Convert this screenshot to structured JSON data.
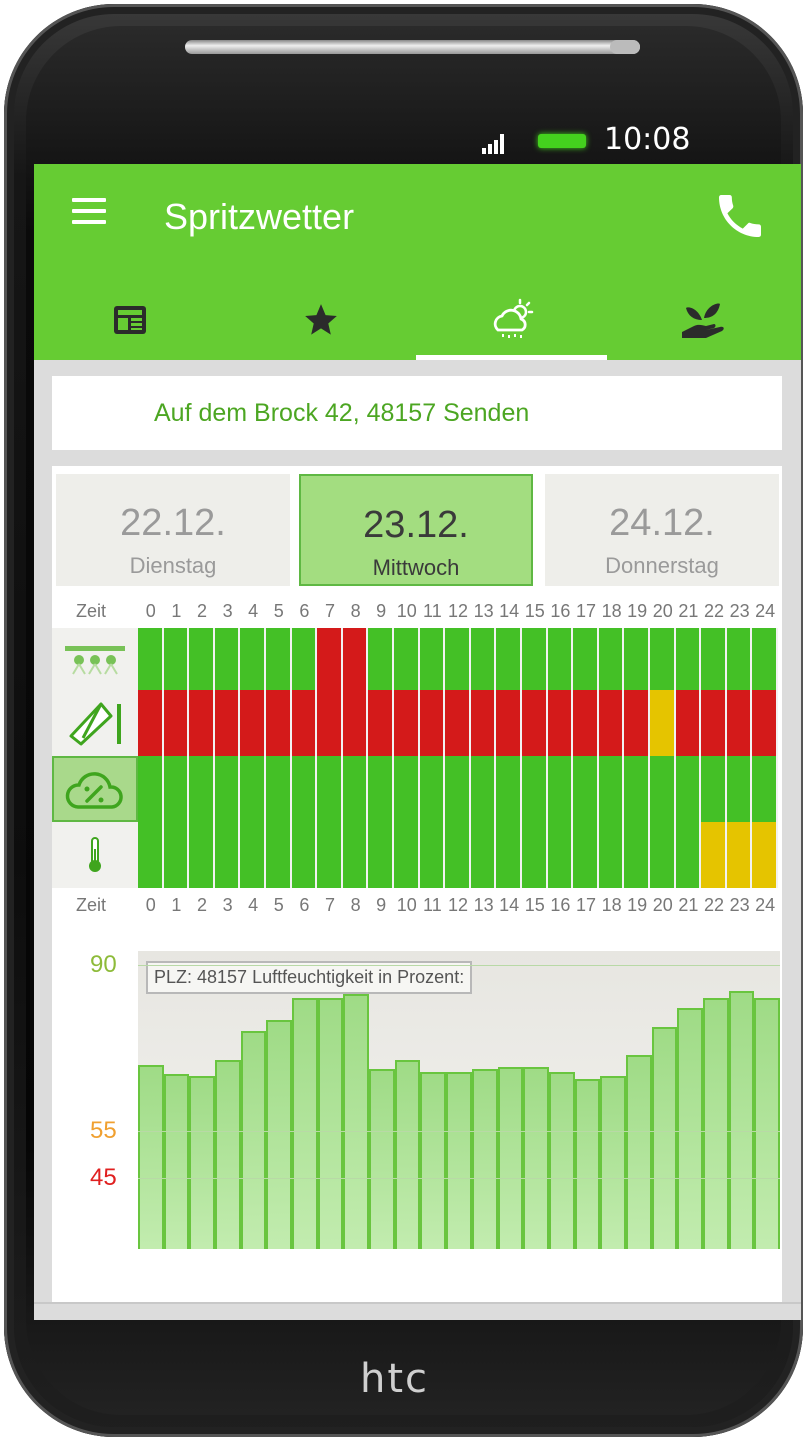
{
  "status_bar": {
    "time": "10:08"
  },
  "app_bar": {
    "title": "Spritzwetter"
  },
  "icons": {
    "menu": "menu-icon",
    "call": "phone-icon",
    "tabs": [
      "news-icon",
      "star-icon",
      "weather-icon",
      "plant-hand-icon"
    ]
  },
  "tabs": {
    "active_index": 2
  },
  "address": "Auf dem Brock 42, 48157 Senden",
  "days": [
    {
      "date": "22.12.",
      "weekday": "Dienstag",
      "active": false
    },
    {
      "date": "23.12.",
      "weekday": "Mittwoch",
      "active": true
    },
    {
      "date": "24.12.",
      "weekday": "Donnerstag",
      "active": false
    }
  ],
  "timeline": {
    "label": "Zeit",
    "hours": [
      "0",
      "1",
      "2",
      "3",
      "4",
      "5",
      "6",
      "7",
      "8",
      "9",
      "10",
      "11",
      "12",
      "13",
      "14",
      "15",
      "16",
      "17",
      "18",
      "19",
      "20",
      "21",
      "22",
      "23",
      "24"
    ]
  },
  "grid_rows": [
    {
      "icon": "sprayer-icon",
      "selected": false,
      "statuses": [
        "g",
        "g",
        "g",
        "g",
        "g",
        "g",
        "g",
        "r",
        "r",
        "g",
        "g",
        "g",
        "g",
        "g",
        "g",
        "g",
        "g",
        "g",
        "g",
        "g",
        "g",
        "g",
        "g",
        "g",
        "g"
      ]
    },
    {
      "icon": "wind-sock-icon",
      "selected": false,
      "statuses": [
        "r",
        "r",
        "r",
        "r",
        "r",
        "r",
        "r",
        "r",
        "r",
        "r",
        "r",
        "r",
        "r",
        "r",
        "r",
        "r",
        "r",
        "r",
        "r",
        "r",
        "y",
        "r",
        "r",
        "r",
        "r"
      ]
    },
    {
      "icon": "cloud-humidity-icon",
      "selected": true,
      "statuses": [
        "g",
        "g",
        "g",
        "g",
        "g",
        "g",
        "g",
        "g",
        "g",
        "g",
        "g",
        "g",
        "g",
        "g",
        "g",
        "g",
        "g",
        "g",
        "g",
        "g",
        "g",
        "g",
        "g",
        "g",
        "g"
      ]
    },
    {
      "icon": "thermometer-icon",
      "selected": false,
      "statuses": [
        "g",
        "g",
        "g",
        "g",
        "g",
        "g",
        "g",
        "g",
        "g",
        "g",
        "g",
        "g",
        "g",
        "g",
        "g",
        "g",
        "g",
        "g",
        "g",
        "g",
        "g",
        "g",
        "y",
        "y",
        "y"
      ]
    }
  ],
  "status_colors": {
    "g": "#44c026",
    "r": "#d41a1a",
    "y": "#e5c400"
  },
  "chart_data": {
    "type": "bar",
    "title": "PLZ: 48157 Luftfeuchtigkeit in Prozent:",
    "categories": [
      "0",
      "1",
      "2",
      "3",
      "4",
      "5",
      "6",
      "7",
      "8",
      "9",
      "10",
      "11",
      "12",
      "13",
      "14",
      "15",
      "16",
      "17",
      "18",
      "19",
      "20",
      "21",
      "22",
      "23",
      "24"
    ],
    "values": [
      69,
      67,
      66.5,
      70,
      76,
      78.5,
      83,
      83,
      84,
      68,
      70,
      67.5,
      67.5,
      68,
      68.5,
      68.5,
      67.5,
      66,
      66.5,
      71,
      77,
      81,
      83,
      84.5,
      83
    ],
    "ylim": [
      30,
      93
    ],
    "y_marks": [
      {
        "value": 90,
        "label": "90",
        "color": "#8dbb39"
      },
      {
        "value": 55,
        "label": "55",
        "color": "#f0a030"
      },
      {
        "value": 45,
        "label": "45",
        "color": "#e02020"
      }
    ]
  },
  "device": {
    "brand": "htc"
  }
}
